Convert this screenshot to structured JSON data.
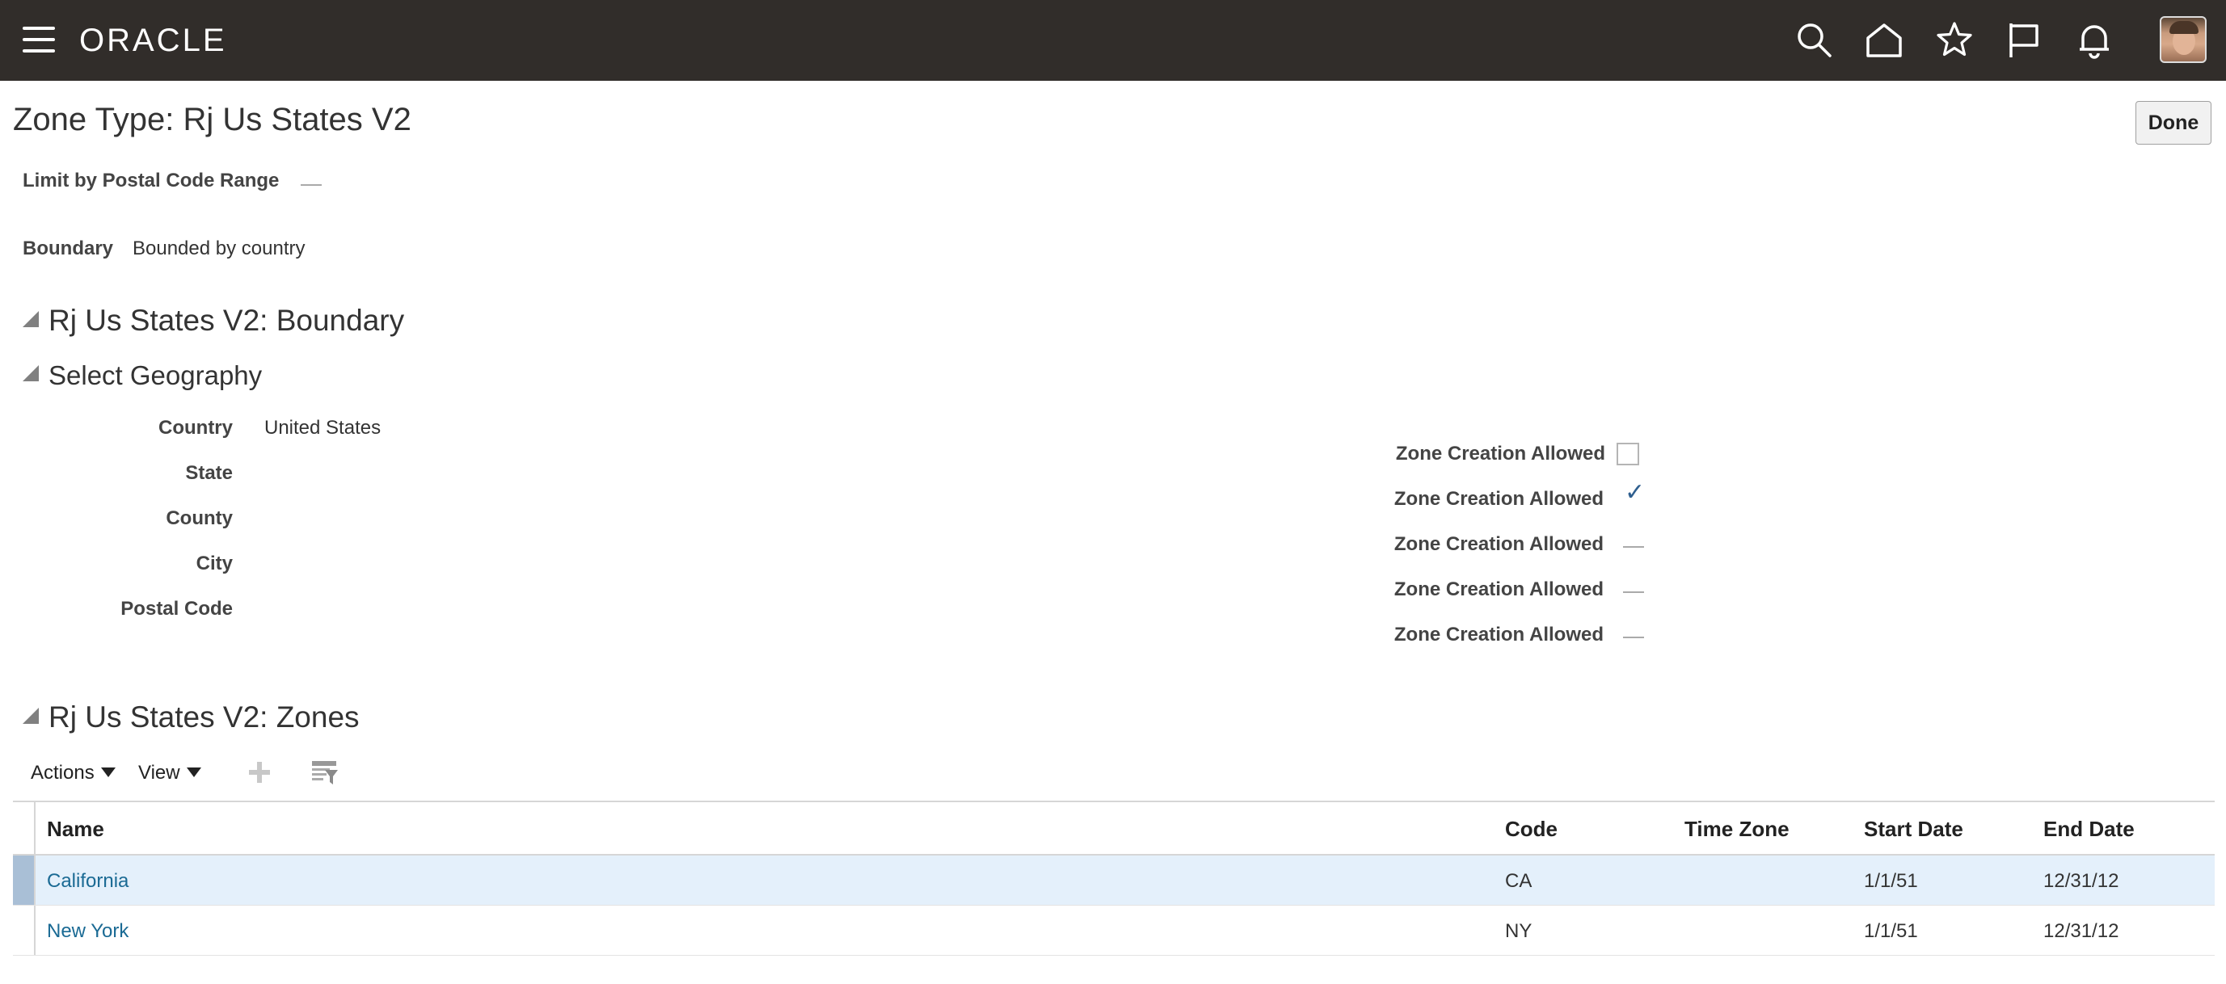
{
  "header": {
    "logo": "ORACLE",
    "icons": [
      "search-icon",
      "home-icon",
      "star-icon",
      "flag-icon",
      "bell-icon"
    ]
  },
  "page": {
    "title": "Zone Type: Rj Us States V2",
    "done_label": "Done"
  },
  "fields": {
    "limit_label": "Limit by Postal Code Range",
    "boundary_label": "Boundary",
    "boundary_value": "Bounded by country"
  },
  "sections": {
    "boundary": "Rj Us States V2: Boundary",
    "select_geography": "Select Geography",
    "zones": "Rj Us States V2: Zones"
  },
  "geography": {
    "levels": [
      {
        "label": "Country",
        "value": "United States",
        "zone_creation_label": "Zone Creation Allowed",
        "zone_creation": "unchecked"
      },
      {
        "label": "State",
        "value": "",
        "zone_creation_label": "Zone Creation Allowed",
        "zone_creation": "checked"
      },
      {
        "label": "County",
        "value": "",
        "zone_creation_label": "Zone Creation Allowed",
        "zone_creation": "none"
      },
      {
        "label": "City",
        "value": "",
        "zone_creation_label": "Zone Creation Allowed",
        "zone_creation": "none"
      },
      {
        "label": "Postal Code",
        "value": "",
        "zone_creation_label": "Zone Creation Allowed",
        "zone_creation": "none"
      }
    ]
  },
  "toolbar": {
    "actions": "Actions",
    "view": "View"
  },
  "table": {
    "columns": [
      "Name",
      "Code",
      "Time Zone",
      "Start Date",
      "End Date"
    ],
    "rows": [
      {
        "name": "California",
        "code": "CA",
        "time_zone": "",
        "start_date": "1/1/51",
        "end_date": "12/31/12",
        "selected": true
      },
      {
        "name": "New York",
        "code": "NY",
        "time_zone": "",
        "start_date": "1/1/51",
        "end_date": "12/31/12",
        "selected": false
      }
    ]
  },
  "colors": {
    "topbar": "#312d2a",
    "link": "#1a6a94",
    "selected_row": "#e4f0fb"
  }
}
